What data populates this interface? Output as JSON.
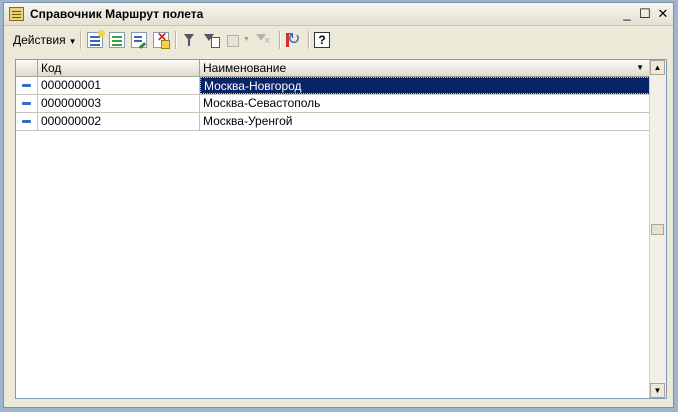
{
  "window": {
    "title": "Справочник Маршрут полета",
    "minimize_glyph": "_",
    "maximize_glyph": "☐",
    "close_glyph": "✕"
  },
  "toolbar": {
    "actions_label": "Действия",
    "buttons": [
      {
        "icon": "add-item-icon"
      },
      {
        "icon": "copy-item-icon"
      },
      {
        "icon": "edit-item-icon"
      },
      {
        "icon": "delete-item-icon"
      },
      {
        "icon": "filter-icon"
      },
      {
        "icon": "filter-by-value-icon"
      },
      {
        "icon": "tree-view-icon"
      },
      {
        "icon": "clear-filter-icon"
      },
      {
        "icon": "refresh-icon"
      },
      {
        "icon": "help-icon",
        "label": "?"
      }
    ]
  },
  "table": {
    "columns": [
      "Код",
      "Наименование"
    ],
    "rows": [
      {
        "code": "000000001",
        "name": "Москва-Новгород",
        "selected": true
      },
      {
        "code": "000000003",
        "name": "Москва-Севастополь",
        "selected": false
      },
      {
        "code": "000000002",
        "name": "Москва-Уренгой",
        "selected": false
      }
    ]
  },
  "colors": {
    "selection": "#0a246a",
    "window_bg": "#ece9d8",
    "row_icon": "#2f6ec6"
  }
}
